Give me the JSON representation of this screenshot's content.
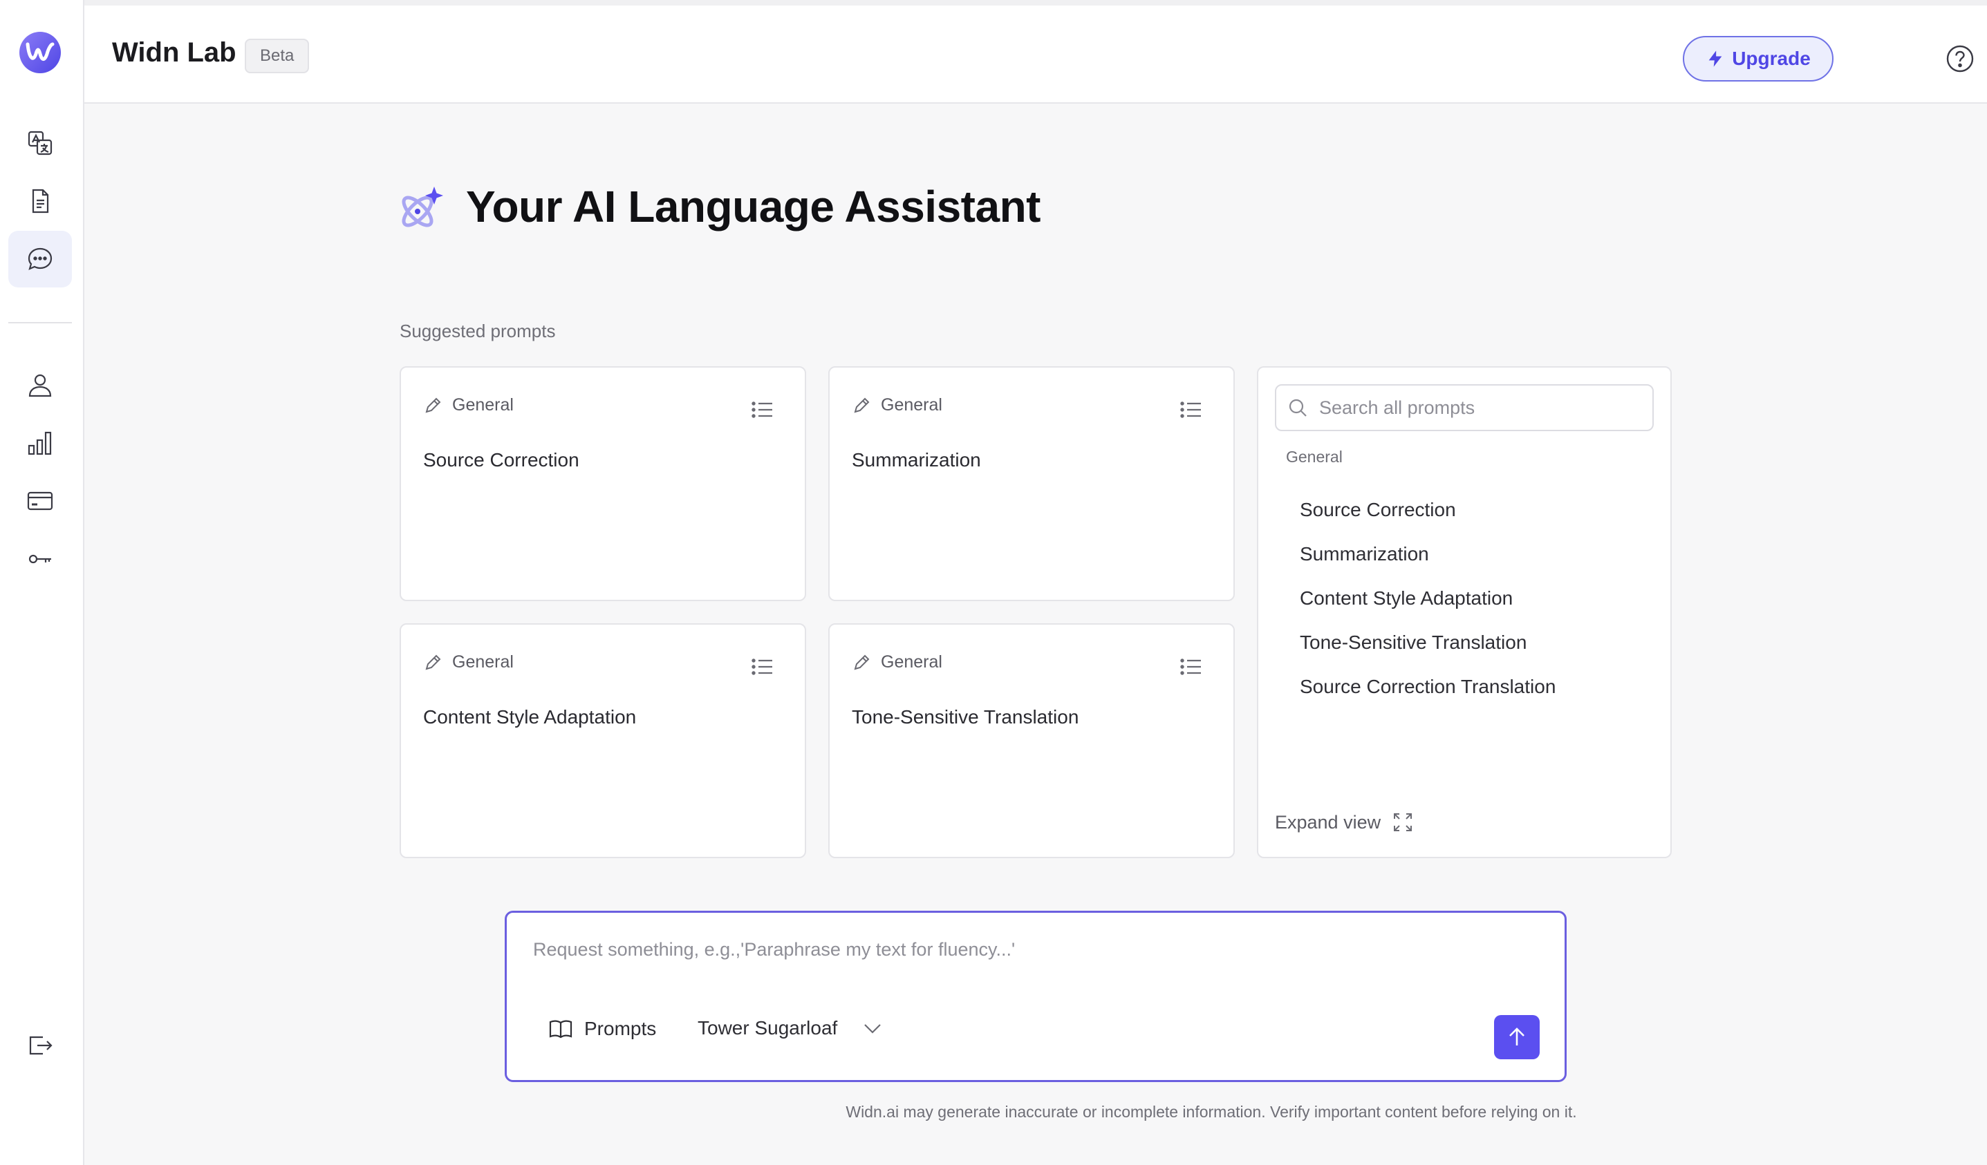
{
  "app": {
    "title": "Widn Lab",
    "badge": "Beta",
    "accent_color": "#5b4ff0"
  },
  "header": {
    "upgrade_label": "Upgrade",
    "upgrade_icon": "bolt-icon",
    "help_icon": "help-circle-icon"
  },
  "sidebar": {
    "logo": "widn-logo",
    "items": [
      {
        "name": "translate",
        "icon": "translate-icon",
        "active": false
      },
      {
        "name": "documents",
        "icon": "document-icon",
        "active": false
      },
      {
        "name": "chat",
        "icon": "chat-bubble-icon",
        "active": true
      },
      {
        "name": "profile",
        "icon": "user-icon",
        "active": false
      },
      {
        "name": "usage",
        "icon": "bar-chart-icon",
        "active": false
      },
      {
        "name": "billing",
        "icon": "credit-card-icon",
        "active": false
      },
      {
        "name": "api-keys",
        "icon": "key-icon",
        "active": false
      }
    ],
    "logout_icon": "logout-icon"
  },
  "main": {
    "hero_title": "Your AI Language Assistant",
    "section_label": "Suggested prompts",
    "cards": [
      {
        "category": "General",
        "title": "Source Correction"
      },
      {
        "category": "General",
        "title": "Summarization"
      },
      {
        "category": "General",
        "title": "Content Style Adaptation"
      },
      {
        "category": "General",
        "title": "Tone-Sensitive Translation"
      }
    ],
    "prompt_panel": {
      "search_placeholder": "Search all prompts",
      "search_value": "",
      "group_label": "General",
      "items": [
        "Source Correction",
        "Summarization",
        "Content Style Adaptation",
        "Tone-Sensitive Translation",
        "Source Correction Translation"
      ],
      "expand_label": "Expand view"
    }
  },
  "composer": {
    "placeholder": "Request something, e.g.,'Paraphrase my text for fluency...'",
    "value": "",
    "prompts_label": "Prompts",
    "model_label": "Tower Sugarloaf",
    "send_icon": "arrow-up-icon"
  },
  "footer": {
    "disclaimer": "Widn.ai may generate inaccurate or incomplete information. Verify important content before relying on it."
  }
}
